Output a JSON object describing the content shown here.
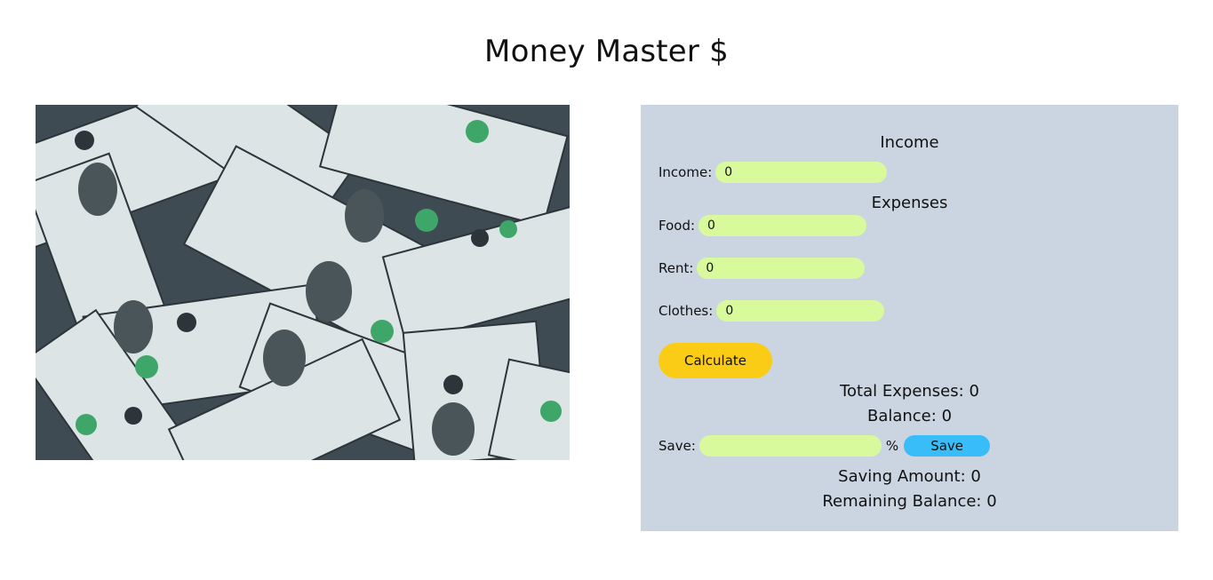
{
  "app": {
    "title": "Money Master $"
  },
  "income": {
    "heading": "Income",
    "label": "Income:",
    "value": "0"
  },
  "expenses": {
    "heading": "Expenses",
    "food": {
      "label": "Food:",
      "value": "0"
    },
    "rent": {
      "label": "Rent:",
      "value": "0"
    },
    "clothes": {
      "label": "Clothes:",
      "value": "0"
    }
  },
  "actions": {
    "calculate_label": "Calculate",
    "save_label": "Save"
  },
  "summary": {
    "total_expenses_label": "Total Expenses:",
    "total_expenses_value": "0",
    "balance_label": "Balance:",
    "balance_value": "0"
  },
  "saving": {
    "label": "Save:",
    "value": "",
    "unit": "%",
    "amount_label": "Saving Amount:",
    "amount_value": "0",
    "remaining_label": "Remaining Balance:",
    "remaining_value": "0"
  },
  "colors": {
    "panel_bg": "#cbd5e1",
    "field_bg": "#d9f99d",
    "calculate_button": "#facc15",
    "save_button": "#38bdf8"
  }
}
